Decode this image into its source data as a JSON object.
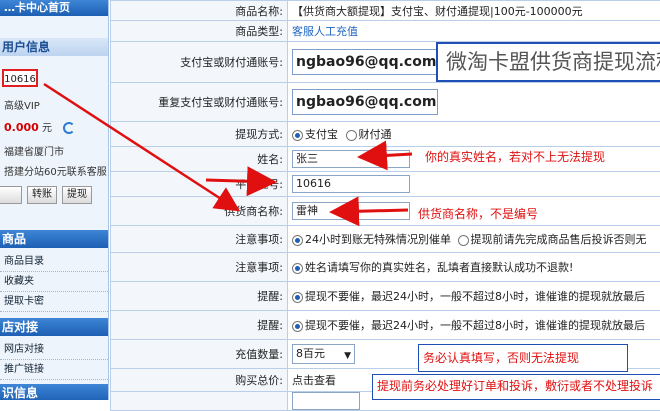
{
  "sidebar": {
    "top_title": "…卡中心首页",
    "user_header": "用户信息",
    "user_id": "10616",
    "level": "高级VIP",
    "balance": "0.000",
    "balance_unit": "元",
    "region": "福建省厦门市",
    "promo": "搭建分站60元联系客服",
    "btn_recharge": "",
    "btn_transfer": "转账",
    "btn_withdraw": "提现",
    "goods_header": "商品",
    "goods_items": [
      "商品目录",
      "收藏夹",
      "提取卡密"
    ],
    "store_header": "店对接",
    "store_items": [
      "网店对接",
      "推广链接"
    ],
    "bottom_header": "识信息"
  },
  "form": {
    "rows": [
      {
        "label": "商品名称:",
        "value": "【供货商大额提现】支付宝、财付通提现|100元-100000元"
      },
      {
        "label": "商品类型:",
        "value": "客服人工充值"
      },
      {
        "label": "支付宝或财付通账号:",
        "value": "ngbao96@qq.com"
      },
      {
        "label": "重复支付宝或财付通账号:",
        "value": "ngbao96@qq.com"
      },
      {
        "label": "提现方式:",
        "opt1": "支付宝",
        "opt2": "财付通"
      },
      {
        "label": "姓名:",
        "value": "张三"
      },
      {
        "label": "平台编号:",
        "value": "10616"
      },
      {
        "label": "供货商名称:",
        "value": "雷神"
      },
      {
        "label": "注意事项:",
        "opt1": "24小时到账无特殊情况別催单",
        "opt2": "提现前请先完成商品售后投诉否则无"
      },
      {
        "label": "注意事项:",
        "value": "姓名请填写你的真实姓名，乱填者直接默认成功不退款!"
      },
      {
        "label": "提醒:",
        "value": "提现不要催，最迟24小时，一般不超过8小时，谁催谁的提现就放最后"
      },
      {
        "label": "提醒:",
        "value": "提现不要催，最迟24小时，一般不超过8小时，谁催谁的提现就放最后"
      },
      {
        "label": "充值数量:",
        "value": "8百元"
      },
      {
        "label": "购买总价:",
        "value": "点击查看"
      },
      {
        "label": "",
        "value": ""
      }
    ]
  },
  "annotations": {
    "title_box": "微淘卡盟供货商提现流程",
    "name_note": "你的真实姓名，若对不上无法提现",
    "supplier_note": "供货商名称，不是编号",
    "fill_note": "务必认真填写，否则无法提现",
    "bottom_note": "提现前务必处理好订单和投诉，敷衍或者不处理投诉"
  },
  "colors": {
    "accent": "#1f5fb5",
    "warn": "#e01010"
  }
}
